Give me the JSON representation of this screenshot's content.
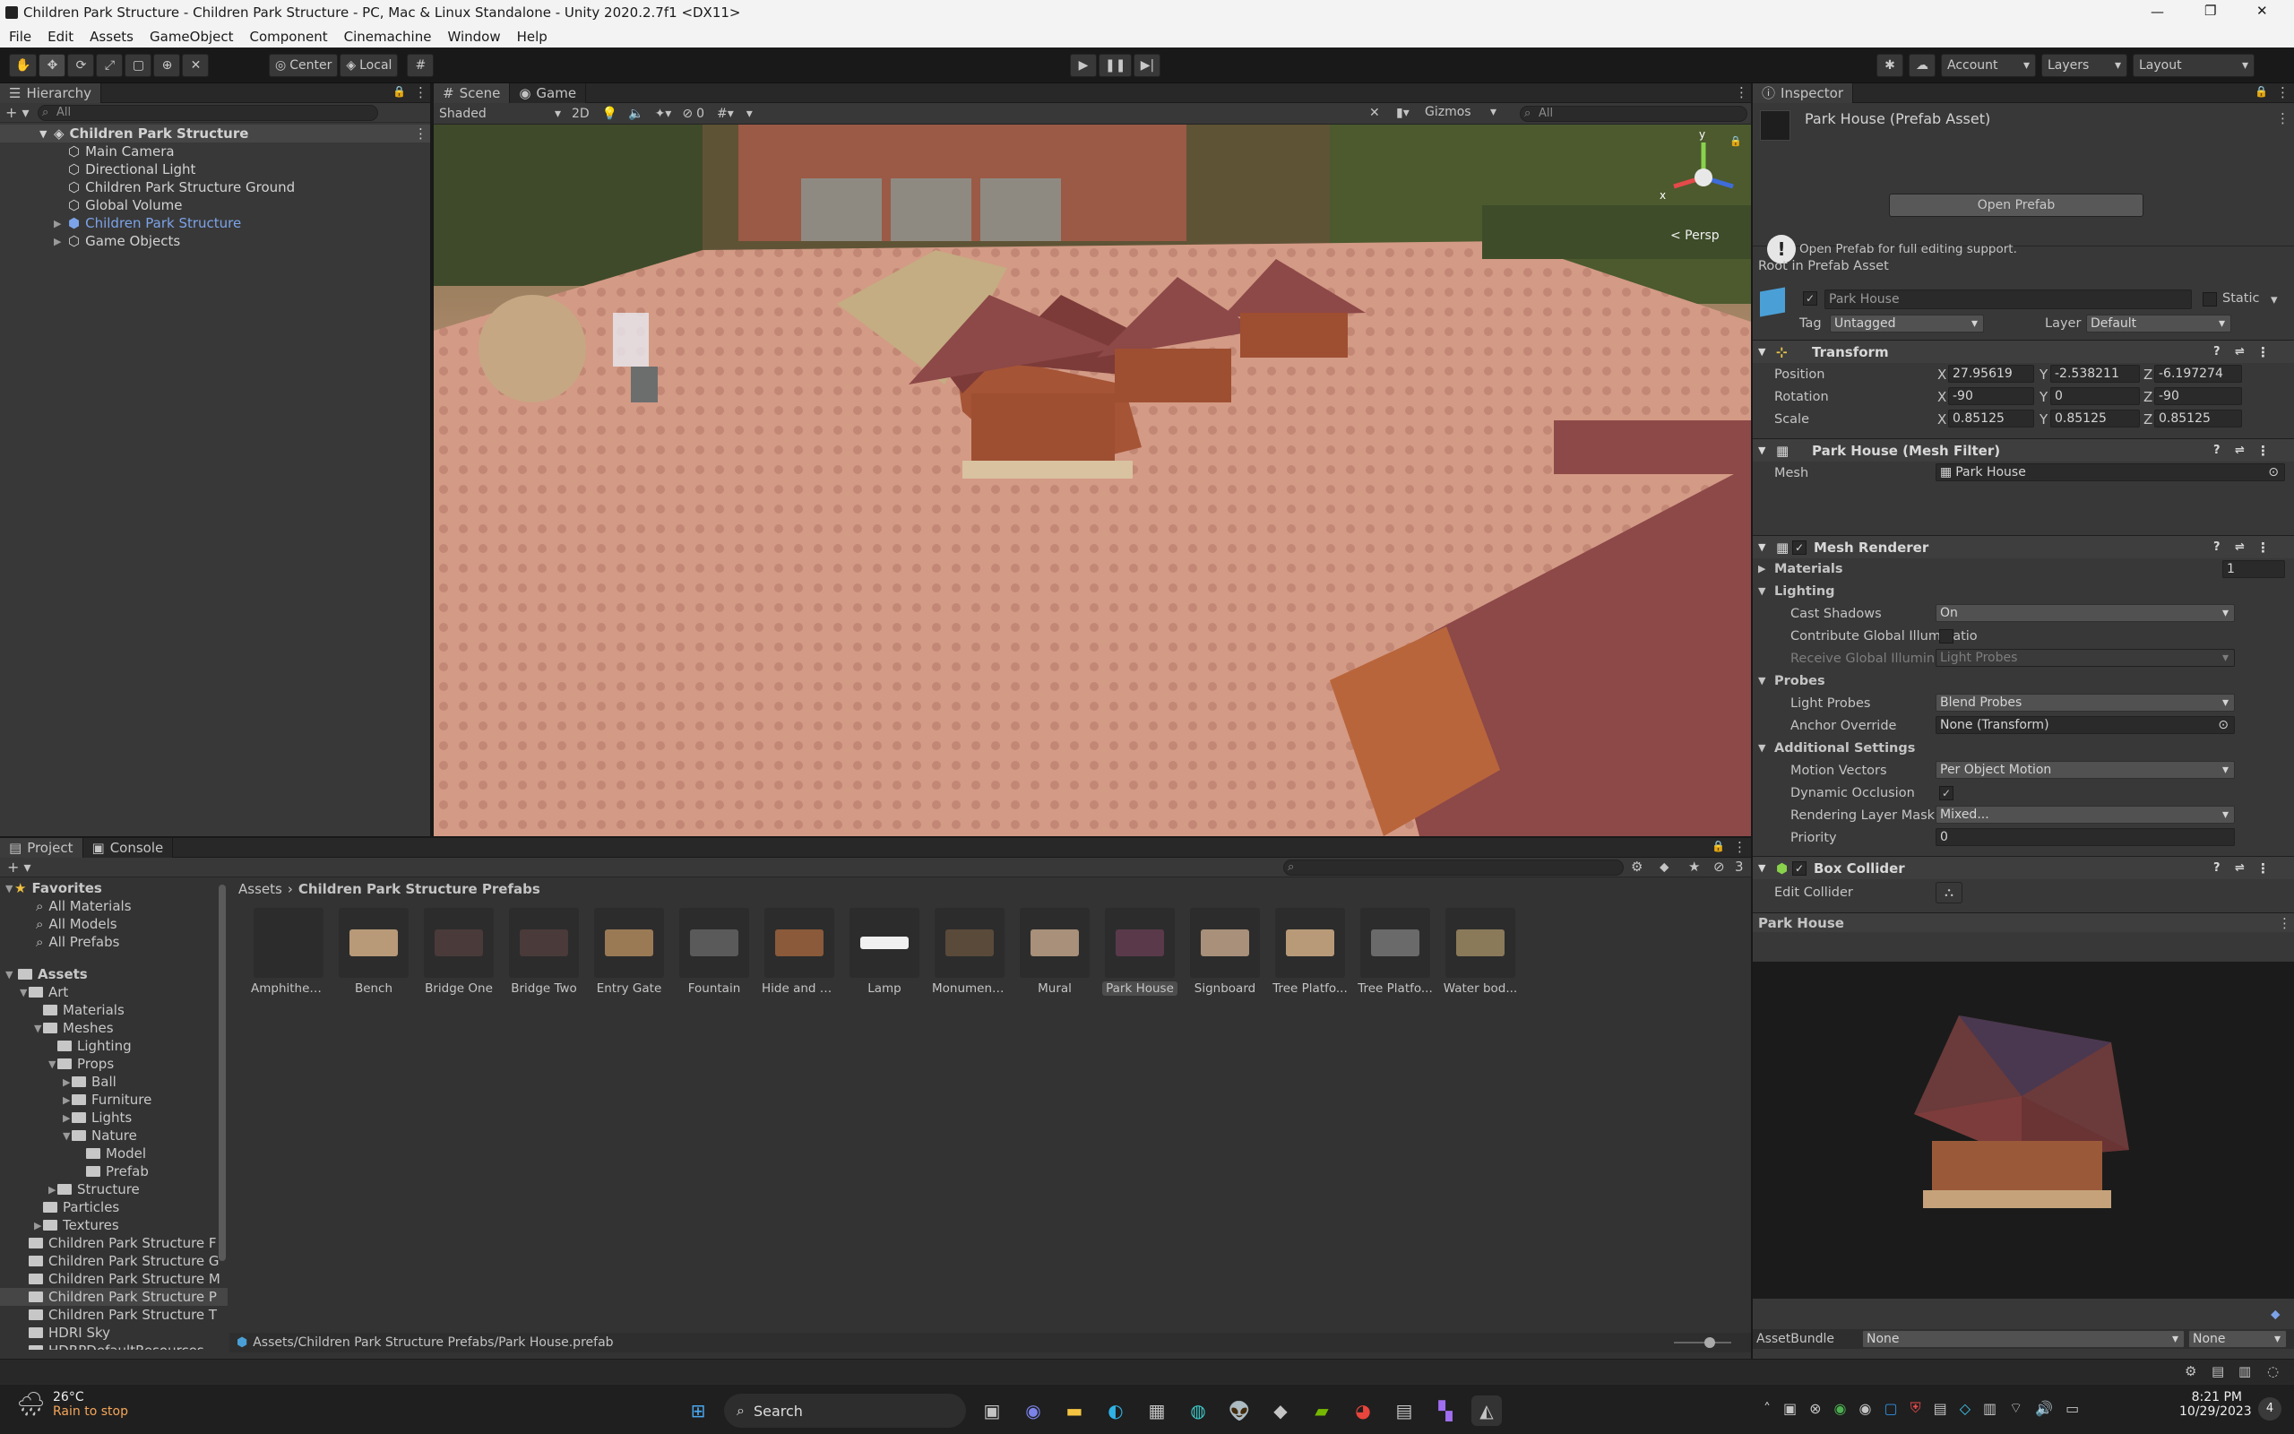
{
  "titlebar": {
    "title": "Children Park Structure - Children Park Structure - PC, Mac & Linux Standalone - Unity 2020.2.7f1 <DX11>"
  },
  "menu": [
    "File",
    "Edit",
    "Assets",
    "GameObject",
    "Component",
    "Cinemachine",
    "Window",
    "Help"
  ],
  "toolbar": {
    "center": "Center",
    "local": "Local",
    "account": "Account",
    "layers": "Layers",
    "layout": "Layout"
  },
  "hierarchy": {
    "tab": "Hierarchy",
    "search_placeholder": "All",
    "root": "Children Park Structure",
    "items": [
      "Main Camera",
      "Directional Light",
      "Children Park Structure Ground",
      "Global Volume",
      "Children Park Structure",
      "Game Objects"
    ]
  },
  "scene": {
    "tabs": [
      "Scene",
      "Game"
    ],
    "shading": "Shaded",
    "mode_2d": "2D",
    "hidden_count": "0",
    "gizmos": "Gizmos",
    "search_placeholder": "All",
    "persp": "< Persp",
    "axis_y": "y",
    "axis_x": "x"
  },
  "inspector": {
    "tab": "Inspector",
    "asset_title": "Park House (Prefab Asset)",
    "open_prefab": "Open Prefab",
    "hint": "Open Prefab for full editing support.",
    "root_label": "Root in Prefab Asset",
    "object_name": "Park House",
    "static": "Static",
    "tag_label": "Tag",
    "tag_value": "Untagged",
    "layer_label": "Layer",
    "layer_value": "Default",
    "transform": {
      "title": "Transform",
      "position_label": "Position",
      "px": "27.95619",
      "py": "-2.538211",
      "pz": "-6.197274",
      "rotation_label": "Rotation",
      "rx": "-90",
      "ry": "0",
      "rz": "-90",
      "scale_label": "Scale",
      "sx": "0.85125",
      "sy": "0.85125",
      "sz": "0.85125"
    },
    "mesh_filter": {
      "title": "Park House (Mesh Filter)",
      "mesh_label": "Mesh",
      "mesh_value": "Park House"
    },
    "mesh_renderer": {
      "title": "Mesh Renderer",
      "materials_label": "Materials",
      "materials_count": "1",
      "lighting_label": "Lighting",
      "cast_shadows_label": "Cast Shadows",
      "cast_shadows_value": "On",
      "contribute_gi_label": "Contribute Global Illuminatio",
      "receive_gi_label": "Receive Global Illumination",
      "receive_gi_value": "Light Probes",
      "probes_label": "Probes",
      "light_probes_label": "Light Probes",
      "light_probes_value": "Blend Probes",
      "anchor_label": "Anchor Override",
      "anchor_value": "None (Transform)",
      "additional_label": "Additional Settings",
      "motion_label": "Motion Vectors",
      "motion_value": "Per Object Motion",
      "dynamic_label": "Dynamic Occlusion",
      "rendering_label": "Rendering Layer Mask",
      "rendering_value": "Mixed...",
      "priority_label": "Priority",
      "priority_value": "0"
    },
    "box_collider": {
      "title": "Box Collider",
      "edit_label": "Edit Collider"
    },
    "preview_title": "Park House",
    "assetbundle_label": "AssetBundle",
    "assetbundle_value": "None",
    "assetbundle_variant": "None"
  },
  "project": {
    "tabs": [
      "Project",
      "Console"
    ],
    "hidden_count": "3",
    "favorites_label": "Favorites",
    "favorites": [
      "All Materials",
      "All Models",
      "All Prefabs"
    ],
    "assets_label": "Assets",
    "tree": [
      {
        "label": "Art",
        "depth": 1
      },
      {
        "label": "Materials",
        "depth": 2
      },
      {
        "label": "Meshes",
        "depth": 2
      },
      {
        "label": "Lighting",
        "depth": 3
      },
      {
        "label": "Props",
        "depth": 3
      },
      {
        "label": "Ball",
        "depth": 4
      },
      {
        "label": "Furniture",
        "depth": 4
      },
      {
        "label": "Lights",
        "depth": 4
      },
      {
        "label": "Nature",
        "depth": 4
      },
      {
        "label": "Model",
        "depth": 5
      },
      {
        "label": "Prefab",
        "depth": 5
      },
      {
        "label": "Structure",
        "depth": 3
      },
      {
        "label": "Particles",
        "depth": 2
      },
      {
        "label": "Textures",
        "depth": 2
      },
      {
        "label": "Children Park Structure F",
        "depth": 1
      },
      {
        "label": "Children Park Structure G",
        "depth": 1
      },
      {
        "label": "Children Park Structure M",
        "depth": 1
      },
      {
        "label": "Children Park Structure P",
        "depth": 1
      },
      {
        "label": "Children Park Structure T",
        "depth": 1
      },
      {
        "label": "HDRI Sky",
        "depth": 1
      },
      {
        "label": "HDRPDefaultResources",
        "depth": 1
      }
    ],
    "breadcrumb_root": "Assets",
    "breadcrumb_folder": "Children Park Structure Prefabs",
    "assets": [
      "Amphithea...",
      "Bench",
      "Bridge One",
      "Bridge Two",
      "Entry Gate",
      "Fountain",
      "Hide and S...",
      "Lamp",
      "Monument...",
      "Mural",
      "Park House",
      "Signboard",
      "Tree Platfo...",
      "Tree Platfo...",
      "Water bod..."
    ],
    "selected_path": "Assets/Children Park Structure Prefabs/Park House.prefab"
  },
  "taskbar": {
    "weather_temp": "26°C",
    "weather_desc": "Rain to stop",
    "search": "Search",
    "time": "8:21 PM",
    "date": "10/29/2023",
    "notification_count": "4"
  }
}
